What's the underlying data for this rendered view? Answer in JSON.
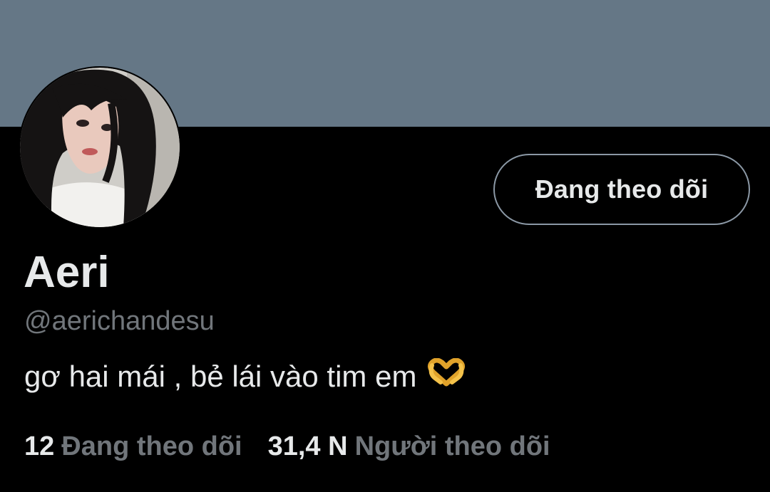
{
  "profile": {
    "display_name": "Aeri",
    "handle": "@aerichandesu",
    "bio": "gơ hai mái , bẻ lái vào tim em",
    "bio_emoji": "heart-hands-emoji",
    "follow_button_label": "Đang theo dõi"
  },
  "stats": {
    "following_count": "12",
    "following_label": "Đang theo dõi",
    "followers_count": "31,4 N",
    "followers_label": "Người theo dõi"
  },
  "colors": {
    "banner": "#657786",
    "background": "#000000",
    "primary_text": "#e7e9ea",
    "secondary_text": "#71767b",
    "button_border": "#8b98a5"
  }
}
